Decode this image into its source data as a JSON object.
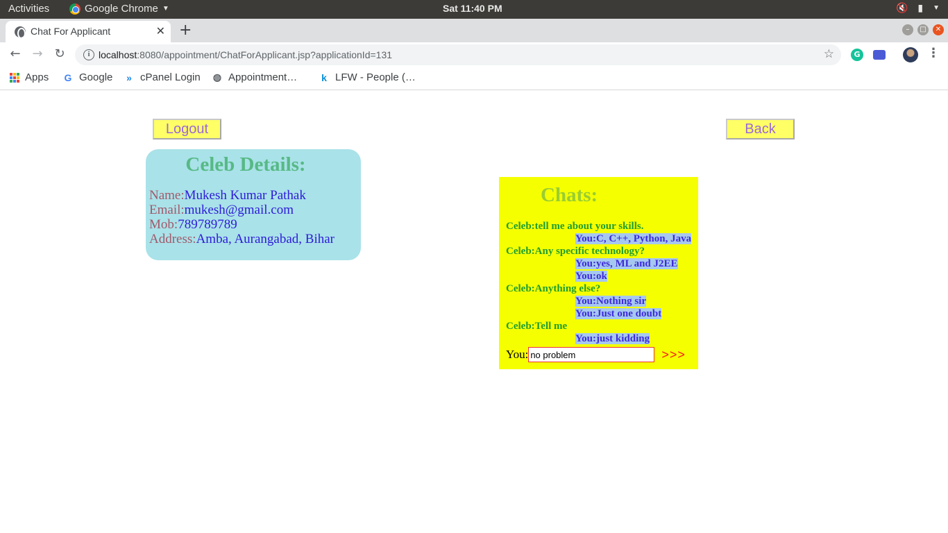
{
  "system_bar": {
    "activities": "Activities",
    "app_name": "Google Chrome",
    "clock": "Sat 11:40 PM"
  },
  "browser": {
    "tab_title": "Chat For Applicant",
    "url_host": "localhost",
    "url_rest": ":8080/appointment/ChatForApplicant.jsp?applicationId=131",
    "bookmarks": [
      {
        "label": "Apps",
        "icon": "apps-grid-icon"
      },
      {
        "label": "Google",
        "icon": "google-icon"
      },
      {
        "label": "cPanel Login",
        "icon": "cpanel-icon"
      },
      {
        "label": "Appointment…",
        "icon": "globe-icon"
      },
      {
        "label": "LFW - People (…",
        "icon": "k-icon"
      }
    ]
  },
  "page": {
    "logout_label": "Logout",
    "back_label": "Back",
    "celeb": {
      "heading": "Celeb Details:",
      "name_label": "Name:",
      "name": "Mukesh Kumar Pathak",
      "email_label": "Email:",
      "email": "mukesh@gmail.com",
      "mob_label": "Mob:",
      "mob": "789789789",
      "address_label": "Address:",
      "address": "Amba, Aurangabad, Bihar"
    },
    "chat": {
      "heading": "Chats:",
      "messages": [
        {
          "from": "celeb",
          "text": "Celeb:tell me about your skills."
        },
        {
          "from": "you",
          "text": "You:C, C++, Python, Java"
        },
        {
          "from": "celeb",
          "text": "Celeb:Any specific technology?"
        },
        {
          "from": "you",
          "text": "You:yes, ML and J2EE"
        },
        {
          "from": "you",
          "text": "You:ok"
        },
        {
          "from": "celeb",
          "text": "Celeb:Anything else?"
        },
        {
          "from": "you",
          "text": "You:Nothing sir"
        },
        {
          "from": "you",
          "text": "You:Just one doubt"
        },
        {
          "from": "celeb",
          "text": "Celeb:Tell me"
        },
        {
          "from": "you",
          "text": "You:just kidding"
        }
      ],
      "input_label": "You:",
      "input_value": "no problem",
      "send_label": ">>>"
    }
  }
}
